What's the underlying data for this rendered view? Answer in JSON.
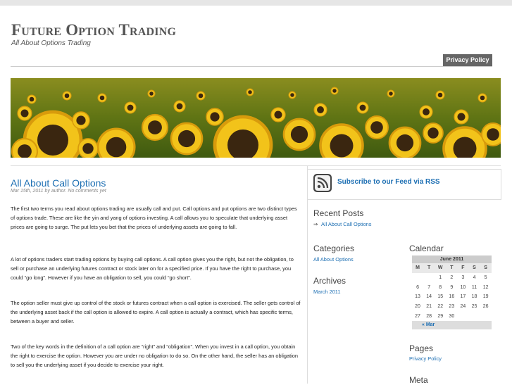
{
  "site": {
    "title": "Future Option Trading",
    "description": "All About Options Trading"
  },
  "nav": {
    "privacy": "Privacy Policy"
  },
  "post": {
    "title": "All About Call Options",
    "meta": "Mar 15th, 2011 by author. No comments yet",
    "paragraphs": [
      "The first two terms you read about options trading are usually call and put. Call options and put options are two distinct types of options trade. These are like the yin and yang of options investing. A call allows you to speculate that underlying asset prices are going to surge. The put lets you bet that the prices of underlying assets are going to fall.",
      "A lot of options traders start trading options by buying call options. A call option gives you the right, but not the obligation, to sell or purchase an underlying futures contract or stock later on for a specified price. If you have the right to purchase, you could “go long”. However if you have an obligation to sell, you could “go short”.",
      "The option seller must give up control of the stock or futures contract when a call option is exercised. The seller gets control of the underlying asset back if the call option is allowed to expire. A call option is actually a contract, which has specific terms, between a buyer and seller.",
      "Two of the key words in the definition of a call option are “right” and “obligation”. When you invest in a call option, you obtain the right to exercise the option. However you are under no obligation to do so. On the other hand, the seller has an obligation to sell you the underlying asset if you decide to exercise your right."
    ]
  },
  "sidebar": {
    "rss": "Subscribe to our Feed via RSS",
    "recent_title": "Recent Posts",
    "recent_item": "All About Call Options",
    "recent_bullet": "⇒",
    "categories_title": "Categories",
    "category_item": "All About Options",
    "archives_title": "Archives",
    "archive_item": "March 2011",
    "calendar_title": "Calendar",
    "pages_title": "Pages",
    "page_item": "Privacy Policy",
    "meta_title": "Meta"
  },
  "calendar": {
    "caption": "June 2011",
    "days": [
      "M",
      "T",
      "W",
      "T",
      "F",
      "S",
      "S"
    ],
    "weeks": [
      [
        "",
        "",
        "1",
        "2",
        "3",
        "4",
        "5"
      ],
      [
        "6",
        "7",
        "8",
        "9",
        "10",
        "11",
        "12"
      ],
      [
        "13",
        "14",
        "15",
        "16",
        "17",
        "18",
        "19"
      ],
      [
        "20",
        "21",
        "22",
        "23",
        "24",
        "25",
        "26"
      ],
      [
        "27",
        "28",
        "29",
        "30",
        "",
        "",
        ""
      ]
    ],
    "prev": "« Mar"
  },
  "colors": {
    "link": "#1d6fb3",
    "nav_bg": "#666666"
  }
}
